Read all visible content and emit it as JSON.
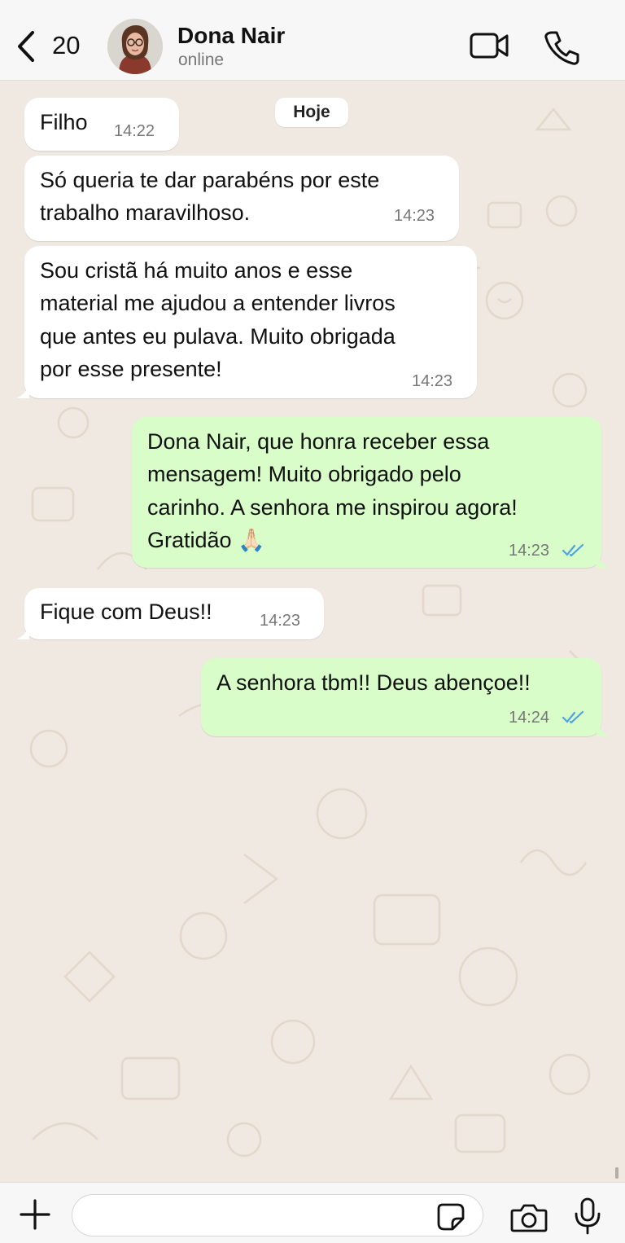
{
  "header": {
    "back_count": "20",
    "contact_name": "Dona Nair",
    "status": "online"
  },
  "chat": {
    "date_chip": "Hoje",
    "messages": [
      {
        "direction": "incoming",
        "lines": [
          "Filho"
        ],
        "time": "14:22"
      },
      {
        "direction": "incoming",
        "lines": [
          "Só queria te dar parabéns por este",
          "trabalho maravilhoso."
        ],
        "time": "14:23"
      },
      {
        "direction": "incoming",
        "lines": [
          "Sou cristã há muito anos e esse",
          "material me ajudou a entender livros",
          "que antes eu pulava. Muito obrigada",
          "por esse presente!"
        ],
        "time": "14:23"
      },
      {
        "direction": "outgoing",
        "lines": [
          "Dona Nair, que honra receber essa",
          "mensagem! Muito obrigado pelo",
          "carinho. A senhora me inspirou agora!",
          "Gratidão 🙏🏻"
        ],
        "time": "14:23",
        "read": true
      },
      {
        "direction": "incoming",
        "lines": [
          "Fique com Deus!!"
        ],
        "time": "14:23"
      },
      {
        "direction": "outgoing",
        "lines": [
          "A senhora tbm!! Deus abençoe!!"
        ],
        "time": "14:24",
        "read": true
      }
    ]
  },
  "footer": {
    "input_value": "",
    "input_placeholder": ""
  },
  "colors": {
    "wallpaper": "#efe9e1",
    "incoming_bubble": "#ffffff",
    "outgoing_bubble": "#d8fdc9",
    "read_ticks": "#4fa3e0"
  },
  "icons": [
    "back-chevron-icon",
    "video-call-icon",
    "phone-call-icon",
    "plus-icon",
    "sticker-icon",
    "camera-icon",
    "mic-icon"
  ]
}
